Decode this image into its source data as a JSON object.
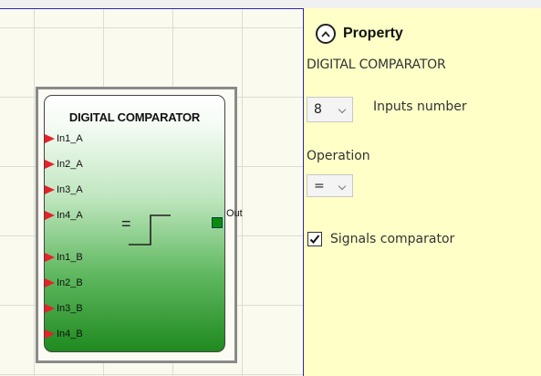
{
  "block": {
    "title": "DIGITAL COMPARATOR",
    "inputs_a": [
      "In1_A",
      "In2_A",
      "In3_A",
      "In4_A"
    ],
    "inputs_b": [
      "In1_B",
      "In2_B",
      "In3_B",
      "In4_B"
    ],
    "operator": "=",
    "output": "Out"
  },
  "property": {
    "title": "Property",
    "subtitle": "DIGITAL COMPARATOR",
    "inputs_number_value": "8",
    "inputs_number_label": "Inputs number",
    "operation_label": "Operation",
    "operation_value": "=",
    "signals_comparator_label": "Signals comparator",
    "signals_comparator_checked": true
  },
  "colors": {
    "canvas_bg": "#fafaef",
    "panel_bg": "#ffffc8",
    "input_triangle": "#e8202a",
    "output_square": "#0d8a0d",
    "block_gradient_bottom": "#1f8a1f"
  }
}
